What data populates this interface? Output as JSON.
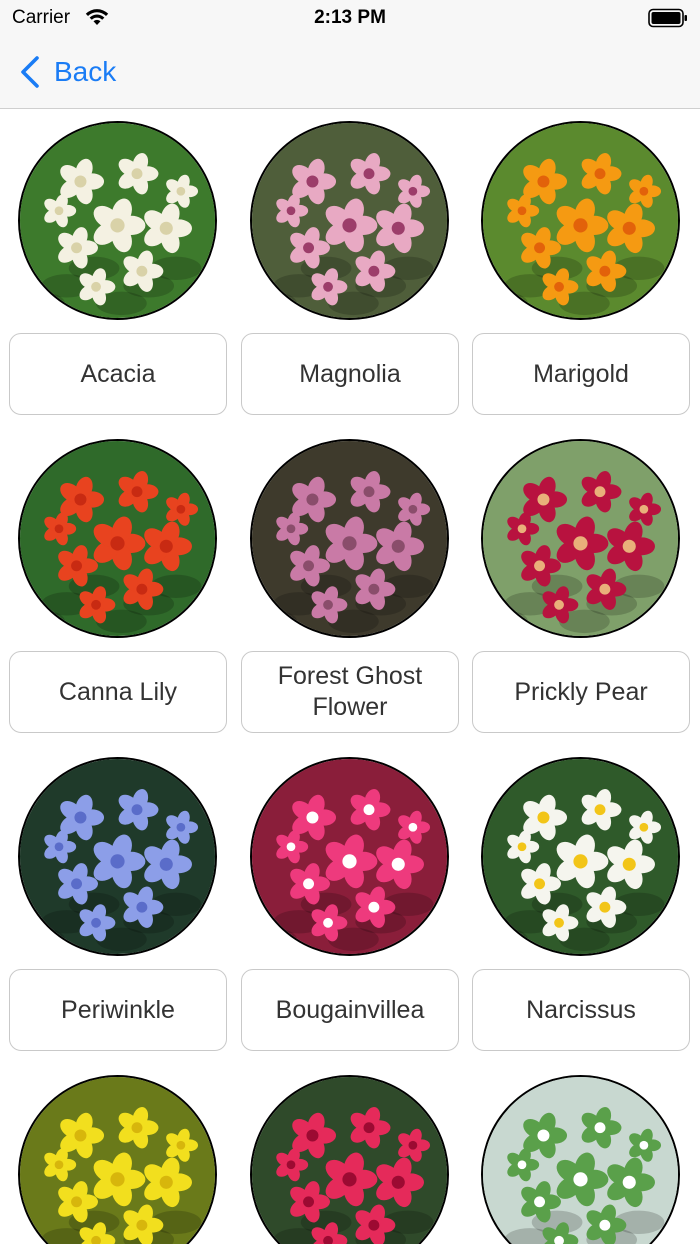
{
  "status_bar": {
    "carrier": "Carrier",
    "time": "2:13 PM"
  },
  "nav": {
    "back_label": "Back",
    "accent_color": "#1a7cf5"
  },
  "flowers": [
    {
      "name": "Acacia",
      "icon": "acacia-photo",
      "colors": {
        "bg": "#3d7a2c",
        "petal": "#f4f1e2",
        "center": "#d9d2a8"
      }
    },
    {
      "name": "Magnolia",
      "icon": "magnolia-photo",
      "colors": {
        "bg": "#4f5e3a",
        "petal": "#e8a9c3",
        "center": "#9c3d6a"
      }
    },
    {
      "name": "Marigold",
      "icon": "marigold-photo",
      "colors": {
        "bg": "#5b8a2e",
        "petal": "#f59a12",
        "center": "#e2620a"
      }
    },
    {
      "name": "Canna Lily",
      "icon": "canna-lily-photo",
      "colors": {
        "bg": "#2f6a2a",
        "petal": "#e8431f",
        "center": "#c82a12"
      }
    },
    {
      "name": "Forest Ghost Flower",
      "icon": "forest-ghost-flower-photo",
      "colors": {
        "bg": "#3e3a2c",
        "petal": "#c97aa6",
        "center": "#8a4d6b"
      }
    },
    {
      "name": "Prickly Pear",
      "icon": "prickly-pear-photo",
      "colors": {
        "bg": "#7fa06a",
        "petal": "#b8123f",
        "center": "#e9b07a"
      }
    },
    {
      "name": "Periwinkle",
      "icon": "periwinkle-photo",
      "colors": {
        "bg": "#1f3a2a",
        "petal": "#8c9ee8",
        "center": "#5a6cc9"
      }
    },
    {
      "name": "Bougainvillea",
      "icon": "bougainvillea-photo",
      "colors": {
        "bg": "#8a1e3a",
        "petal": "#ee3a7d",
        "center": "#ffffff"
      }
    },
    {
      "name": "Narcissus",
      "icon": "narcissus-photo",
      "colors": {
        "bg": "#2f5a2a",
        "petal": "#f5f5ee",
        "center": "#f2c518"
      }
    },
    {
      "name": "",
      "icon": "golden-shower-photo",
      "colors": {
        "bg": "#6a7a1a",
        "petal": "#f2df1e",
        "center": "#d7b60c"
      }
    },
    {
      "name": "",
      "icon": "hibiscus-photo",
      "colors": {
        "bg": "#2f4a2a",
        "petal": "#e52a5a",
        "center": "#9c0a32"
      }
    },
    {
      "name": "",
      "icon": "aloe-vera-photo",
      "colors": {
        "bg": "#c8d8d0",
        "petal": "#5aa04a",
        "center": "#ffffff"
      }
    }
  ]
}
